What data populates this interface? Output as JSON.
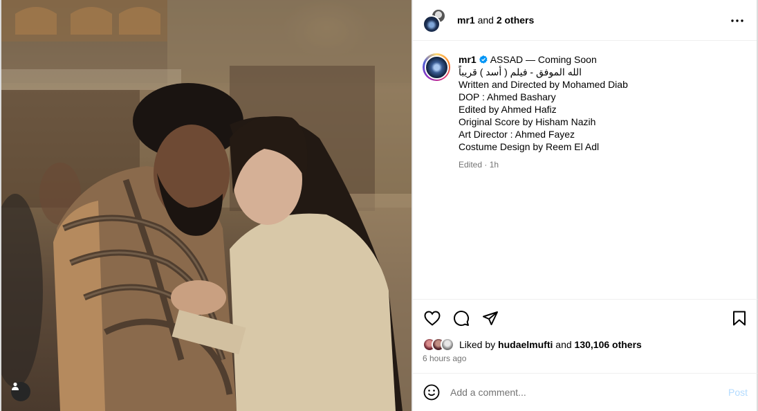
{
  "header": {
    "username": "mr1",
    "collaborators_text": "and 2 others",
    "more_icon": "more-horizontal-icon"
  },
  "caption": {
    "username": "mr1",
    "verified_icon": "verified-badge-icon",
    "title": "ASSAD — Coming Soon",
    "lines": [
      "الله الموفق - فيلم ( أسد ) قريباً",
      "Written and Directed by Mohamed Diab",
      "DOP : Ahmed Bashary",
      "Edited by Ahmed Hafiz",
      "Original Score by Hisham Nazih",
      "Art Director : Ahmed Fayez",
      "Costume Design by Reem El Adl"
    ],
    "meta": "Edited · 1h"
  },
  "actions": {
    "like_icon": "heart-icon",
    "comment_icon": "comment-icon",
    "share_icon": "paper-plane-icon",
    "save_icon": "bookmark-icon"
  },
  "likes": {
    "prefix": "Liked by",
    "user": "hudaelmufti",
    "conj": "and",
    "count": "130,106 others"
  },
  "timestamp": "6 hours ago",
  "comment": {
    "placeholder": "Add a comment...",
    "post_label": "Post",
    "emoji_icon": "emoji-icon"
  },
  "media": {
    "user_tag_icon": "user-tag-icon"
  },
  "colors": {
    "verified": "#0095f6",
    "post_disabled": "#b3dbff",
    "secondary_text": "#737373"
  }
}
